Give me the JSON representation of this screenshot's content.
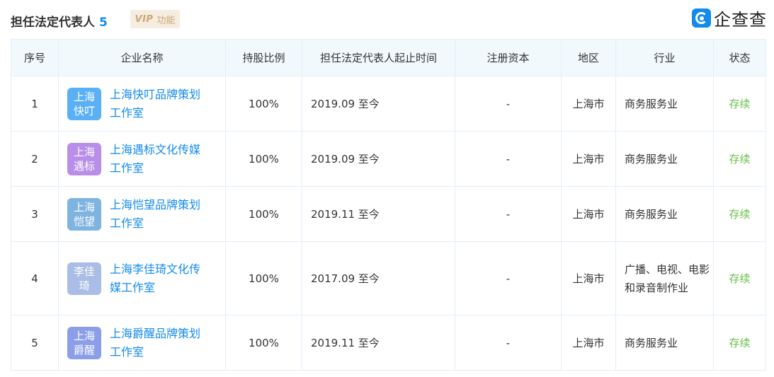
{
  "header": {
    "title": "担任法定代表人",
    "count": "5",
    "vip_label": "VIP",
    "vip_feature": "功能",
    "brand_name": "企查查"
  },
  "table": {
    "columns": [
      "序号",
      "企业名称",
      "持股比例",
      "担任法定代表人起止时间",
      "注册资本",
      "地区",
      "行业",
      "状态"
    ],
    "rows": [
      {
        "index": "1",
        "logo_text": "上海快叮",
        "logo_color": "#5ab0f5",
        "name": "上海快叮品牌策划工作室",
        "share": "100%",
        "period": "2019.09 至今",
        "capital": "-",
        "region": "上海市",
        "industry": "商务服务业",
        "status": "存续"
      },
      {
        "index": "2",
        "logo_text": "上海遇标",
        "logo_color": "#b98ee8",
        "name": "上海遇标文化传媒工作室",
        "share": "100%",
        "period": "2019.09 至今",
        "capital": "-",
        "region": "上海市",
        "industry": "商务服务业",
        "status": "存续"
      },
      {
        "index": "3",
        "logo_text": "上海恺望",
        "logo_color": "#7fb3e0",
        "name": "上海恺望品牌策划工作室",
        "share": "100%",
        "period": "2019.11 至今",
        "capital": "-",
        "region": "上海市",
        "industry": "商务服务业",
        "status": "存续"
      },
      {
        "index": "4",
        "logo_text": "李佳琦",
        "logo_color": "#a9bde6",
        "name": "上海李佳琦文化传媒工作室",
        "share": "100%",
        "period": "2017.09 至今",
        "capital": "-",
        "region": "上海市",
        "industry": "广播、电视、电影和录音制作业",
        "status": "存续"
      },
      {
        "index": "5",
        "logo_text": "上海爵醒",
        "logo_color": "#8c9ee8",
        "name": "上海爵醒品牌策划工作室",
        "share": "100%",
        "period": "2019.11 至今",
        "capital": "-",
        "region": "上海市",
        "industry": "商务服务业",
        "status": "存续"
      }
    ]
  }
}
